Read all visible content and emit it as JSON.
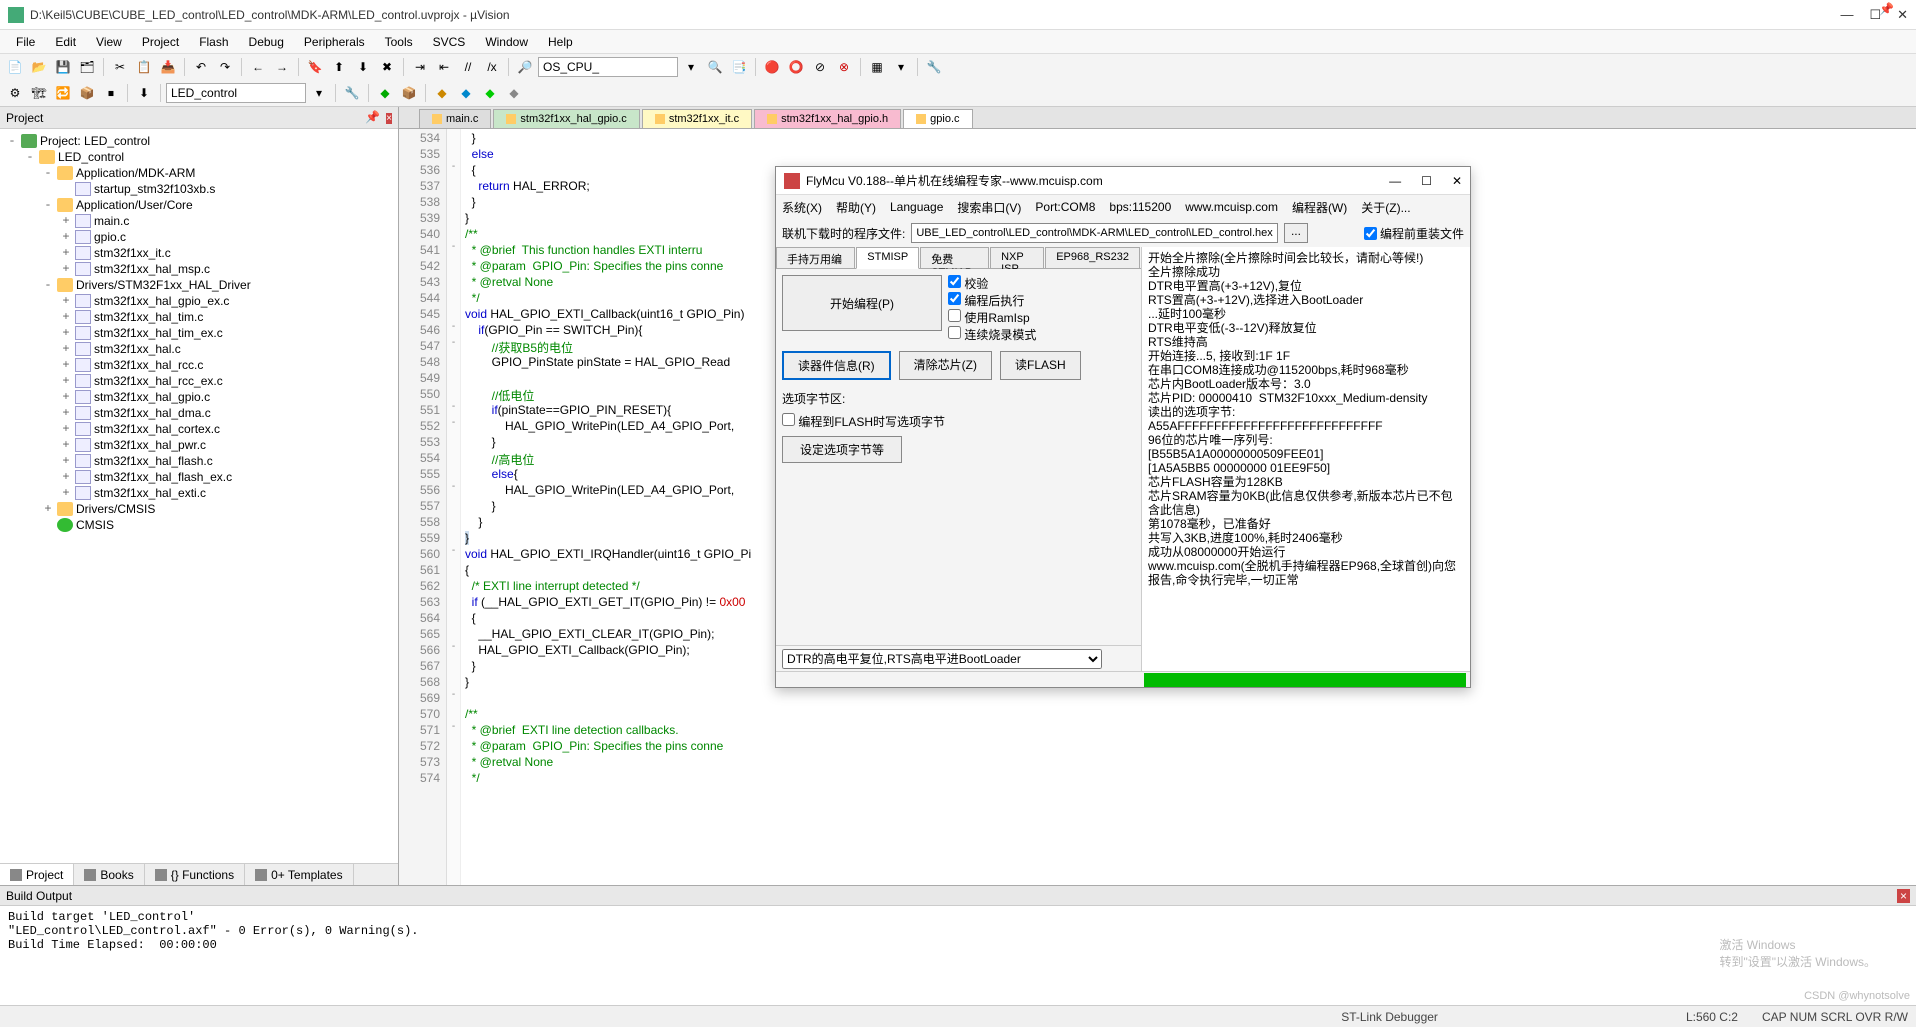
{
  "window": {
    "title": "D:\\Keil5\\CUBE\\CUBE_LED_control\\LED_control\\MDK-ARM\\LED_control.uvprojx - µVision",
    "min": "—",
    "max": "☐",
    "close": "✕"
  },
  "menubar": [
    "File",
    "Edit",
    "View",
    "Project",
    "Flash",
    "Debug",
    "Peripherals",
    "Tools",
    "SVCS",
    "Window",
    "Help"
  ],
  "toolbar1": {
    "combo1": "OS_CPU_"
  },
  "toolbar2": {
    "target": "LED_control"
  },
  "projectPanel": {
    "title": "Project",
    "tree": [
      {
        "lvl": 0,
        "toggle": "-",
        "icon": "ico-prj",
        "label": "Project: LED_control"
      },
      {
        "lvl": 1,
        "toggle": "-",
        "icon": "ico-fld",
        "label": "LED_control"
      },
      {
        "lvl": 2,
        "toggle": "-",
        "icon": "ico-fld",
        "label": "Application/MDK-ARM"
      },
      {
        "lvl": 3,
        "toggle": "",
        "icon": "ico-c",
        "label": "startup_stm32f103xb.s"
      },
      {
        "lvl": 2,
        "toggle": "-",
        "icon": "ico-fld",
        "label": "Application/User/Core"
      },
      {
        "lvl": 3,
        "toggle": "+",
        "icon": "ico-c",
        "label": "main.c"
      },
      {
        "lvl": 3,
        "toggle": "+",
        "icon": "ico-c",
        "label": "gpio.c"
      },
      {
        "lvl": 3,
        "toggle": "+",
        "icon": "ico-c",
        "label": "stm32f1xx_it.c"
      },
      {
        "lvl": 3,
        "toggle": "+",
        "icon": "ico-c",
        "label": "stm32f1xx_hal_msp.c"
      },
      {
        "lvl": 2,
        "toggle": "-",
        "icon": "ico-fld",
        "label": "Drivers/STM32F1xx_HAL_Driver"
      },
      {
        "lvl": 3,
        "toggle": "+",
        "icon": "ico-c",
        "label": "stm32f1xx_hal_gpio_ex.c"
      },
      {
        "lvl": 3,
        "toggle": "+",
        "icon": "ico-c",
        "label": "stm32f1xx_hal_tim.c"
      },
      {
        "lvl": 3,
        "toggle": "+",
        "icon": "ico-c",
        "label": "stm32f1xx_hal_tim_ex.c"
      },
      {
        "lvl": 3,
        "toggle": "+",
        "icon": "ico-c",
        "label": "stm32f1xx_hal.c"
      },
      {
        "lvl": 3,
        "toggle": "+",
        "icon": "ico-c",
        "label": "stm32f1xx_hal_rcc.c"
      },
      {
        "lvl": 3,
        "toggle": "+",
        "icon": "ico-c",
        "label": "stm32f1xx_hal_rcc_ex.c"
      },
      {
        "lvl": 3,
        "toggle": "+",
        "icon": "ico-c",
        "label": "stm32f1xx_hal_gpio.c"
      },
      {
        "lvl": 3,
        "toggle": "+",
        "icon": "ico-c",
        "label": "stm32f1xx_hal_dma.c"
      },
      {
        "lvl": 3,
        "toggle": "+",
        "icon": "ico-c",
        "label": "stm32f1xx_hal_cortex.c"
      },
      {
        "lvl": 3,
        "toggle": "+",
        "icon": "ico-c",
        "label": "stm32f1xx_hal_pwr.c"
      },
      {
        "lvl": 3,
        "toggle": "+",
        "icon": "ico-c",
        "label": "stm32f1xx_hal_flash.c"
      },
      {
        "lvl": 3,
        "toggle": "+",
        "icon": "ico-c",
        "label": "stm32f1xx_hal_flash_ex.c"
      },
      {
        "lvl": 3,
        "toggle": "+",
        "icon": "ico-c",
        "label": "stm32f1xx_hal_exti.c"
      },
      {
        "lvl": 2,
        "toggle": "+",
        "icon": "ico-fld",
        "label": "Drivers/CMSIS"
      },
      {
        "lvl": 2,
        "toggle": "",
        "icon": "ico-grn",
        "label": "CMSIS"
      }
    ],
    "tabs": [
      "Project",
      "Books",
      "{} Functions",
      "0+ Templates"
    ]
  },
  "editor": {
    "tabs": [
      {
        "label": "main.c",
        "cls": "ft-grey"
      },
      {
        "label": "stm32f1xx_hal_gpio.c",
        "cls": "ft-green"
      },
      {
        "label": "stm32f1xx_it.c",
        "cls": "ft-yellow"
      },
      {
        "label": "stm32f1xx_hal_gpio.h",
        "cls": "ft-pink"
      },
      {
        "label": "gpio.c",
        "cls": "ft-white"
      }
    ],
    "startLine": 534,
    "fold": [
      "",
      "",
      "-",
      "",
      "",
      "",
      "",
      "-",
      "",
      "",
      "",
      "",
      "-",
      "-",
      "",
      "",
      "",
      "-",
      "-",
      "",
      "",
      "",
      "-",
      "",
      "",
      "",
      "-",
      "",
      "",
      "",
      "",
      "",
      "-",
      "",
      "",
      "-",
      "",
      "-",
      "",
      "",
      "",
      ""
    ],
    "lines": [
      "  }",
      "  <span class='kw'>else</span>",
      "  {",
      "    <span class='kw'>return</span> HAL_ERROR;",
      "  }",
      "}",
      "<span class='cm'>/**</span>",
      "<span class='cm'>  * @brief  This function handles EXTI interru</span>",
      "<span class='cm'>  * @param  GPIO_Pin: Specifies the pins conne</span>",
      "<span class='cm'>  * @retval None</span>",
      "<span class='cm'>  */</span>",
      "<span class='kw'>void</span> HAL_GPIO_EXTI_Callback(uint16_t GPIO_Pin)",
      "    <span class='kw'>if</span>(GPIO_Pin == SWITCH_Pin){",
      "        <span class='cm'>//获取B5的电位</span>",
      "        GPIO_PinState pinState = HAL_GPIO_Read",
      "",
      "        <span class='cm'>//低电位</span>",
      "        <span class='kw'>if</span>(pinState==GPIO_PIN_RESET){",
      "            HAL_GPIO_WritePin(LED_A4_GPIO_Port,",
      "        }",
      "        <span class='cm'>//高电位</span>",
      "        <span class='kw'>else</span>{",
      "            HAL_GPIO_WritePin(LED_A4_GPIO_Port,",
      "        }",
      "    }",
      "<span style='background:#cde'>}</span>",
      "<span class='kw'>void</span> HAL_GPIO_EXTI_IRQHandler(uint16_t GPIO_Pi",
      "{",
      "  <span class='cm'>/* EXTI line interrupt detected */</span>",
      "  <span class='kw'>if</span> (__HAL_GPIO_EXTI_GET_IT(GPIO_Pin) != <span class='num'>0x00</span>",
      "  {",
      "    __HAL_GPIO_EXTI_CLEAR_IT(GPIO_Pin);",
      "    HAL_GPIO_EXTI_Callback(GPIO_Pin);",
      "  }",
      "}",
      "",
      "<span class='cm'>/**</span>",
      "<span class='cm'>  * @brief  EXTI line detection callbacks.</span>",
      "<span class='cm'>  * @param  GPIO_Pin: Specifies the pins conne</span>",
      "<span class='cm'>  * @retval None</span>",
      "<span class='cm'>  */</span>"
    ]
  },
  "buildOutput": {
    "title": "Build Output",
    "text": "Build target 'LED_control'\n\"LED_control\\LED_control.axf\" - 0 Error(s), 0 Warning(s).\nBuild Time Elapsed:  00:00:00"
  },
  "statusbar": {
    "debugger": "ST-Link Debugger",
    "pos": "L:560 C:2",
    "caps": "CAP  NUM  SCRL  OVR  R/W"
  },
  "flymcu": {
    "title": "FlyMcu V0.188--单片机在线编程专家--www.mcuisp.com",
    "menu": [
      "系统(X)",
      "帮助(Y)",
      "Language",
      "搜索串口(V)",
      "Port:COM8",
      "bps:115200",
      "www.mcuisp.com",
      "编程器(W)",
      "关于(Z)..."
    ],
    "row1Label": "联机下载时的程序文件:",
    "hexPath": "UBE_LED_control\\LED_control\\MDK-ARM\\LED_control\\LED_control.hex",
    "browse": "...",
    "preWipe": "编程前重装文件",
    "tabs": [
      "手持万用编程器",
      "STMISP",
      "免费STMIAP",
      "NXP ISP",
      "EP968_RS232"
    ],
    "bigBtn": "开始编程(P)",
    "chks": [
      "校验",
      "编程后执行",
      "使用RamIsp",
      "连续烧录模式"
    ],
    "chkStates": [
      true,
      true,
      false,
      false
    ],
    "btnRow": [
      "读器件信息(R)",
      "清除芯片(Z)",
      "读FLASH"
    ],
    "optSection": "选项字节区:",
    "optChk": "编程到FLASH时写选项字节",
    "optBtn": "设定选项字节等",
    "bottomSelect": "DTR的高电平复位,RTS高电平进BootLoader",
    "log": [
      "开始全片擦除(全片擦除时间会比较长，请耐心等候!)",
      "全片擦除成功",
      "DTR电平置高(+3-+12V),复位",
      "RTS置高(+3-+12V),选择进入BootLoader",
      "...延时100毫秒",
      "DTR电平变低(-3--12V)释放复位",
      "RTS维持高",
      "开始连接...5, 接收到:1F 1F",
      "在串口COM8连接成功@115200bps,耗时968毫秒",
      "芯片内BootLoader版本号：3.0",
      "芯片PID: 00000410  STM32F10xxx_Medium-density",
      "读出的选项字节:",
      "A55AFFFFFFFFFFFFFFFFFFFFFFFFFFFF",
      "96位的芯片唯一序列号:",
      "[B55B5A1A00000000509FEE01]",
      "[1A5A5BB5 00000000 01EE9F50]",
      "芯片FLASH容量为128KB",
      "芯片SRAM容量为0KB(此信息仅供参考,新版本芯片已不包含此信息)",
      "第1078毫秒，已准备好",
      "共写入3KB,进度100%,耗时2406毫秒",
      "成功从08000000开始运行",
      "www.mcuisp.com(全脱机手持编程器EP968,全球首创)向您报告,命令执行完毕,一切正常"
    ]
  },
  "watermark": {
    "main": "激活 Windows",
    "sub": "转到\"设置\"以激活 Windows。"
  },
  "csdn": "CSDN @whynotsolve"
}
